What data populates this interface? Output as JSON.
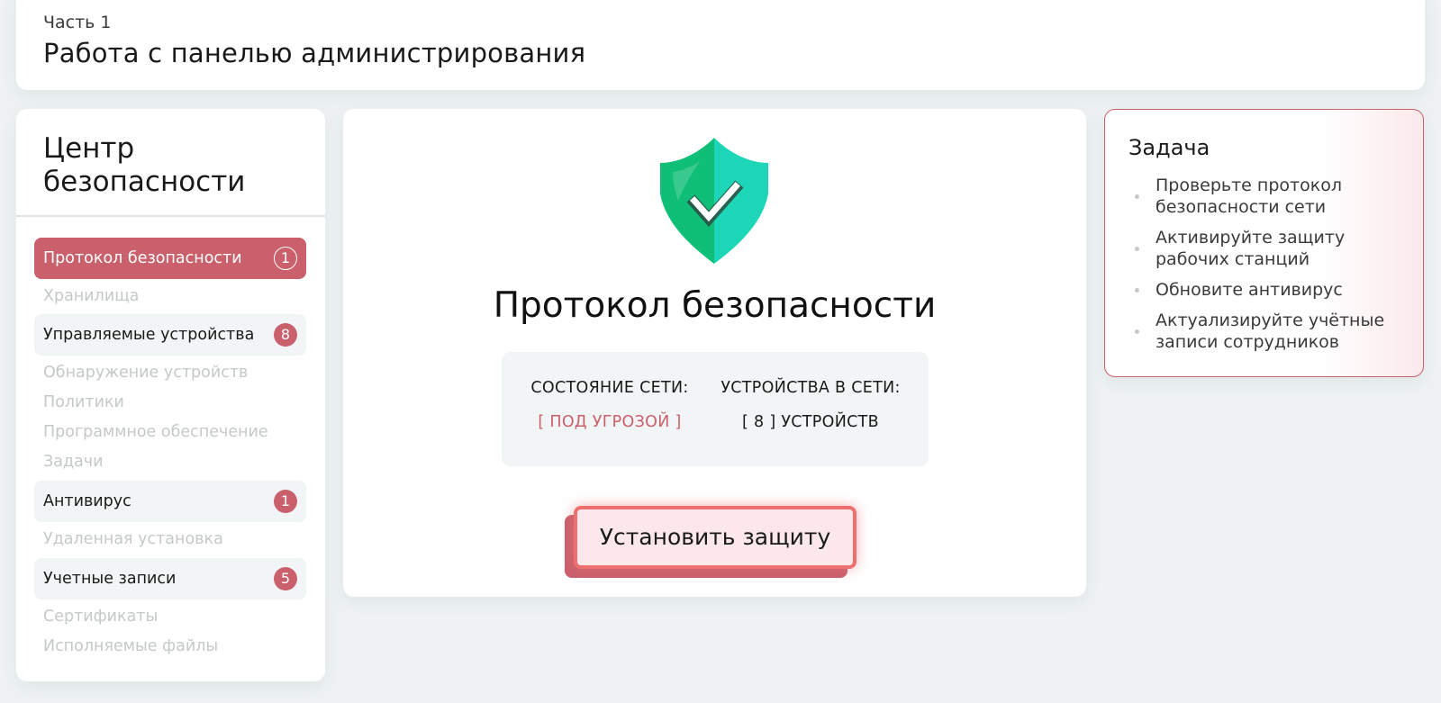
{
  "header": {
    "part": "Часть 1",
    "title": "Работа с панелью администрирования"
  },
  "sidebar": {
    "title": "Центр безопасности",
    "items": [
      {
        "label": "Протокол безопасности",
        "badge": "1",
        "state": "active"
      },
      {
        "label": "Хранилища",
        "state": "disabled"
      },
      {
        "label": "Управляемые устройства",
        "badge": "8",
        "state": "enabled"
      },
      {
        "label": "Обнаружение устройств",
        "state": "disabled"
      },
      {
        "label": "Политики",
        "state": "disabled"
      },
      {
        "label": "Программное обеспечение",
        "state": "disabled"
      },
      {
        "label": "Задачи",
        "state": "disabled"
      },
      {
        "label": "Антивирус",
        "badge": "1",
        "state": "enabled"
      },
      {
        "label": "Удаленная установка",
        "state": "disabled"
      },
      {
        "label": "Учетные записи",
        "badge": "5",
        "state": "enabled"
      },
      {
        "label": "Сертификаты",
        "state": "disabled"
      },
      {
        "label": "Исполняемые файлы",
        "state": "disabled"
      }
    ]
  },
  "main": {
    "icon": "shield-check-icon",
    "title": "Протокол безопасности",
    "status": {
      "network_label": "СОСТОЯНИЕ СЕТИ:",
      "network_value": "[ ПОД УГРОЗОЙ ]",
      "devices_label": "УСТРОЙСТВА В СЕТИ:",
      "devices_value": "[ 8 ] УСТРОЙСТВ"
    },
    "install_button": "Установить защиту"
  },
  "task": {
    "title": "Задача",
    "items": [
      "Проверьте протокол безопасности сети",
      "Активируйте защиту рабочих станций",
      "Обновите антивирус",
      "Актуализируйте учётные записи сотрудников"
    ]
  },
  "colors": {
    "accent": "#c9606c",
    "button_border": "#ec7070",
    "shield_green": "#0fbf78",
    "shield_teal": "#1dd6b7",
    "background": "#eef2f2"
  }
}
